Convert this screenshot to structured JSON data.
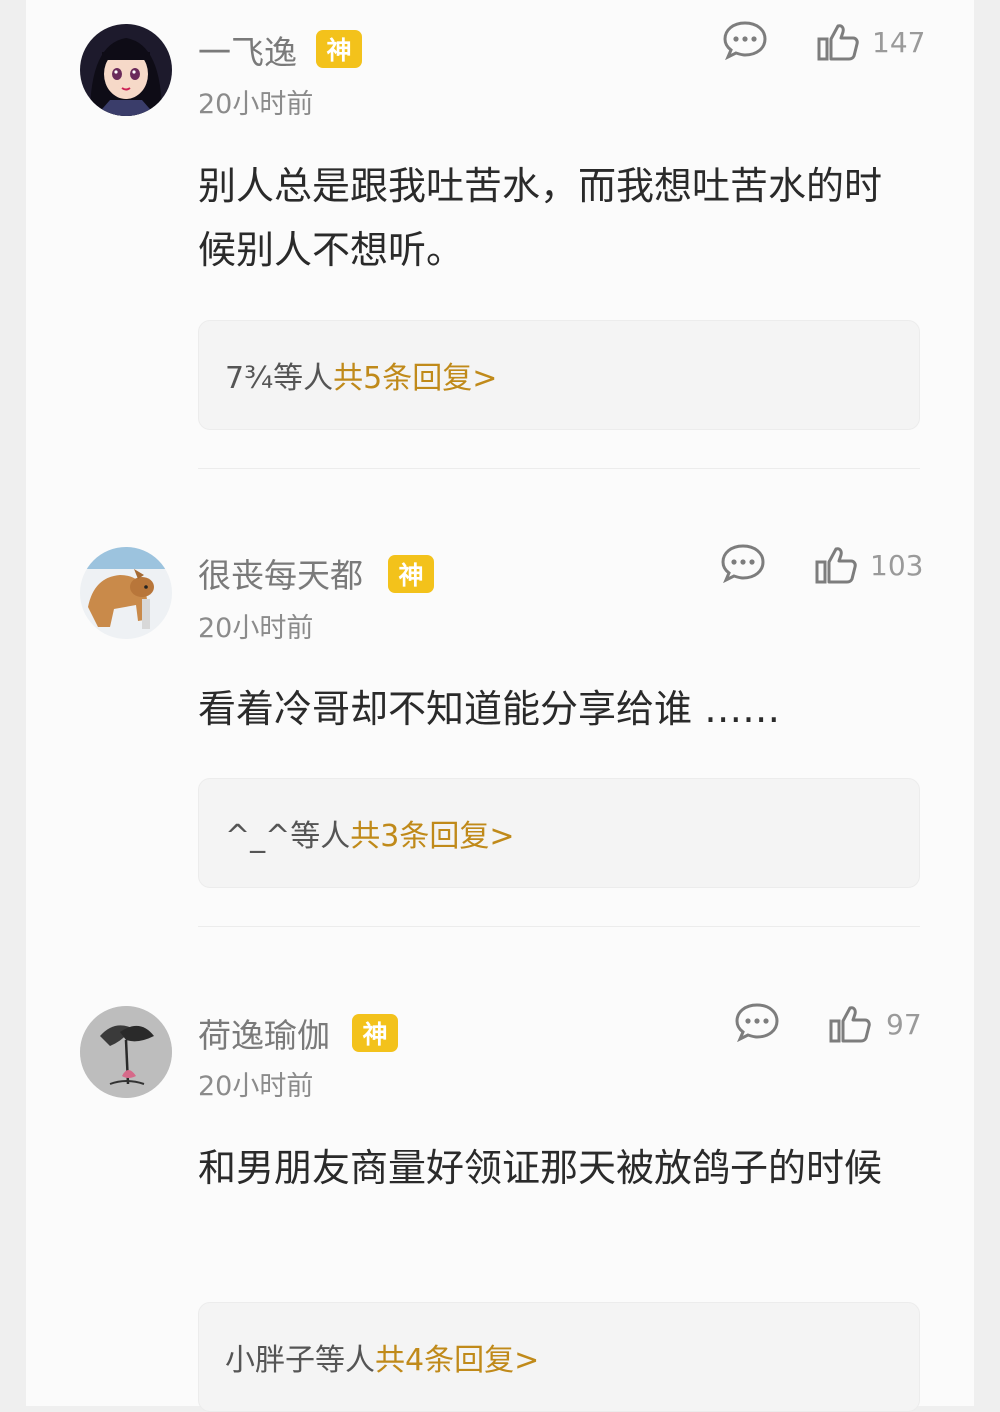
{
  "comments": [
    {
      "username": "一飞逸",
      "badge": "神",
      "time": "20小时前",
      "likes": "147",
      "text": "别人总是跟我吐苦水，而我想吐苦水的时候别人不想听。",
      "reply_names": "7¾等人",
      "reply_link": "共5条回复>"
    },
    {
      "username": "很丧每天都",
      "badge": "神",
      "time": "20小时前",
      "likes": "103",
      "text": "看着冷哥却不知道能分享给谁 ……",
      "reply_names": "^_^等人",
      "reply_link": "共3条回复>"
    },
    {
      "username": "荷逸瑜伽",
      "badge": "神",
      "time": "20小时前",
      "likes": "97",
      "text": "和男朋友商量好领证那天被放鸽子的时候",
      "reply_names": "小胖子等人",
      "reply_link": "共4条回复>"
    }
  ],
  "colors": {
    "badge": "#f3c21b",
    "reply_link": "#c08a1a",
    "card_background": "#fbfbfb"
  },
  "icons": [
    "comment-bubble-icon",
    "thumbs-up-icon"
  ]
}
